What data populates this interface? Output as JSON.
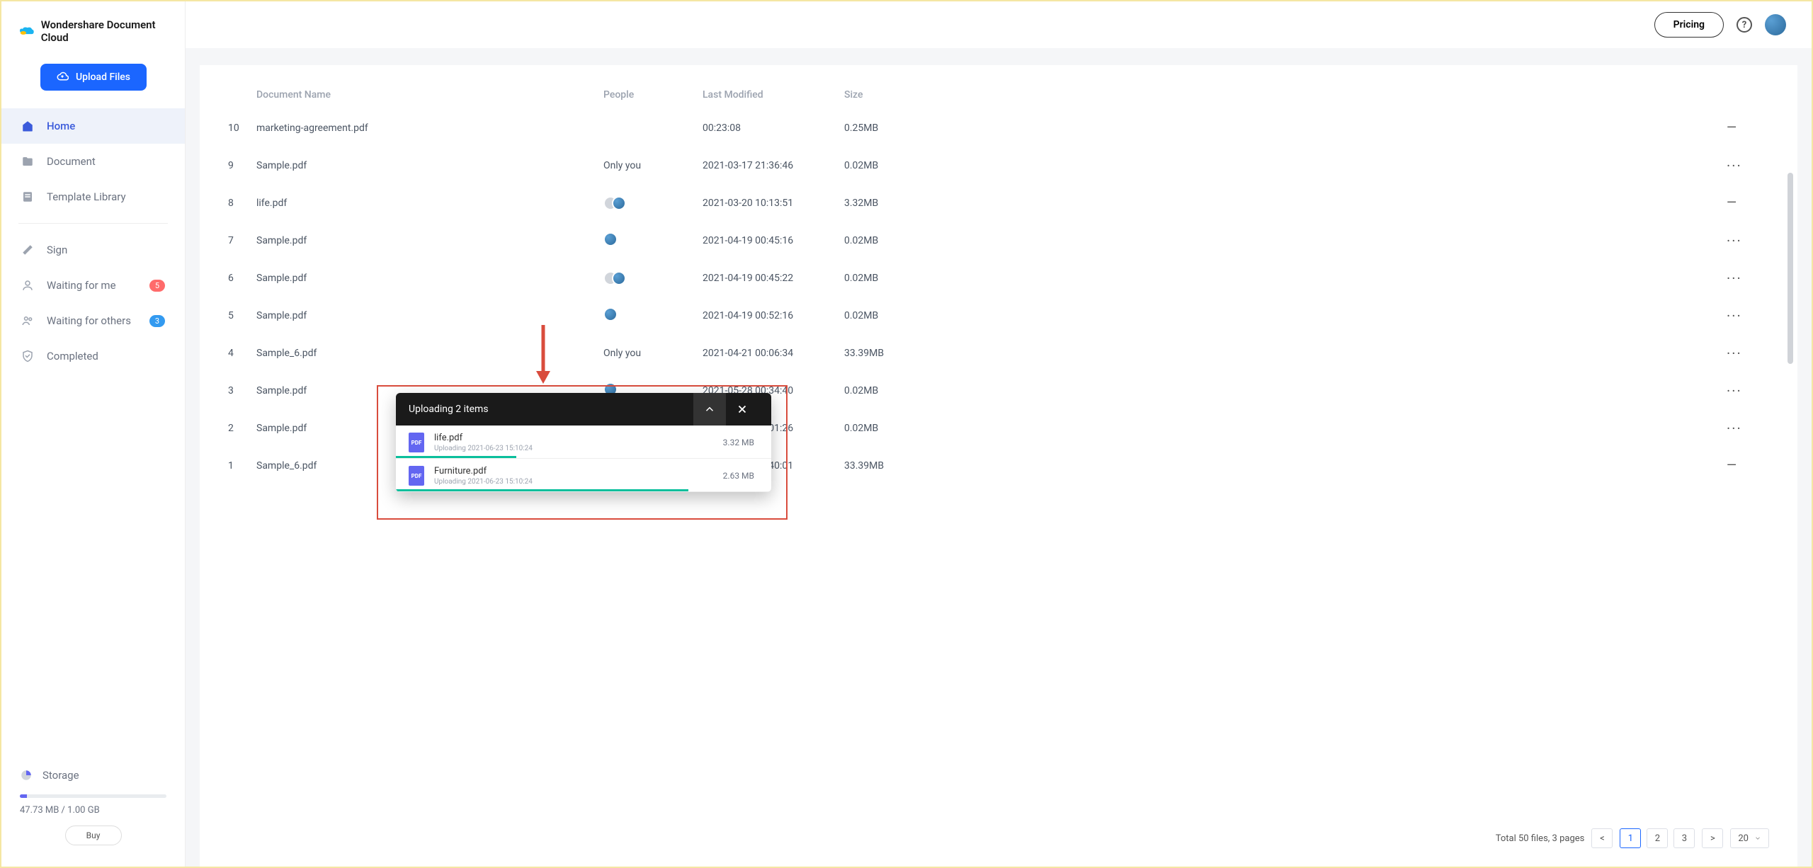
{
  "brand": "Wondershare Document Cloud",
  "upload_button": "Upload Files",
  "nav": {
    "home": "Home",
    "document": "Document",
    "template_library": "Template Library",
    "sign": "Sign",
    "waiting_for_me": "Waiting for me",
    "waiting_for_me_count": "5",
    "waiting_for_others": "Waiting for others",
    "waiting_for_others_count": "3",
    "completed": "Completed"
  },
  "storage": {
    "label": "Storage",
    "text": "47.73 MB / 1.00 GB",
    "buy": "Buy"
  },
  "topbar": {
    "pricing": "Pricing"
  },
  "headers": {
    "name": "Document Name",
    "people": "People",
    "modified": "Last Modified",
    "size": "Size"
  },
  "rows": [
    {
      "idx": "1",
      "name": "Sample_6.pdf",
      "people_type": "none",
      "modified": "2021-05-31 22:40:01",
      "size": "33.39MB",
      "action": "dash"
    },
    {
      "idx": "2",
      "name": "Sample.pdf",
      "people_type": "avatar",
      "modified": "2021-05-30 23:01:26",
      "size": "0.02MB",
      "action": "more"
    },
    {
      "idx": "3",
      "name": "Sample.pdf",
      "people_type": "avatar",
      "modified": "2021-05-28 00:34:40",
      "size": "0.02MB",
      "action": "more"
    },
    {
      "idx": "4",
      "name": "Sample_6.pdf",
      "people_type": "text",
      "people_text": "Only you",
      "modified": "2021-04-21 00:06:34",
      "size": "33.39MB",
      "action": "more"
    },
    {
      "idx": "5",
      "name": "Sample.pdf",
      "people_type": "avatar",
      "modified": "2021-04-19 00:52:16",
      "size": "0.02MB",
      "action": "more"
    },
    {
      "idx": "6",
      "name": "Sample.pdf",
      "people_type": "stack",
      "modified": "2021-04-19 00:45:22",
      "size": "0.02MB",
      "action": "more"
    },
    {
      "idx": "7",
      "name": "Sample.pdf",
      "people_type": "avatar",
      "modified": "2021-04-19 00:45:16",
      "size": "0.02MB",
      "action": "more"
    },
    {
      "idx": "8",
      "name": "life.pdf",
      "people_type": "stack",
      "modified": "2021-03-20 10:13:51",
      "size": "3.32MB",
      "action": "dash"
    },
    {
      "idx": "9",
      "name": "Sample.pdf",
      "people_type": "text",
      "people_text": "Only you",
      "modified": "2021-03-17 21:36:46",
      "size": "0.02MB",
      "action": "more"
    },
    {
      "idx": "10",
      "name": "marketing-agreement.pdf",
      "people_type": "none",
      "modified": "00:23:08",
      "size": "0.25MB",
      "action": "dash"
    }
  ],
  "upload": {
    "title": "Uploading 2 items",
    "items": [
      {
        "name": "life.pdf",
        "status": "Uploading 2021-06-23 15:10:24",
        "size": "3.32 MB",
        "progress": 32
      },
      {
        "name": "Furniture.pdf",
        "status": "Uploading 2021-06-23 15:10:24",
        "size": "2.63 MB",
        "progress": 78
      }
    ]
  },
  "pagination": {
    "summary": "Total 50 files, 3 pages",
    "pages": [
      "1",
      "2",
      "3"
    ],
    "page_size": "20"
  }
}
